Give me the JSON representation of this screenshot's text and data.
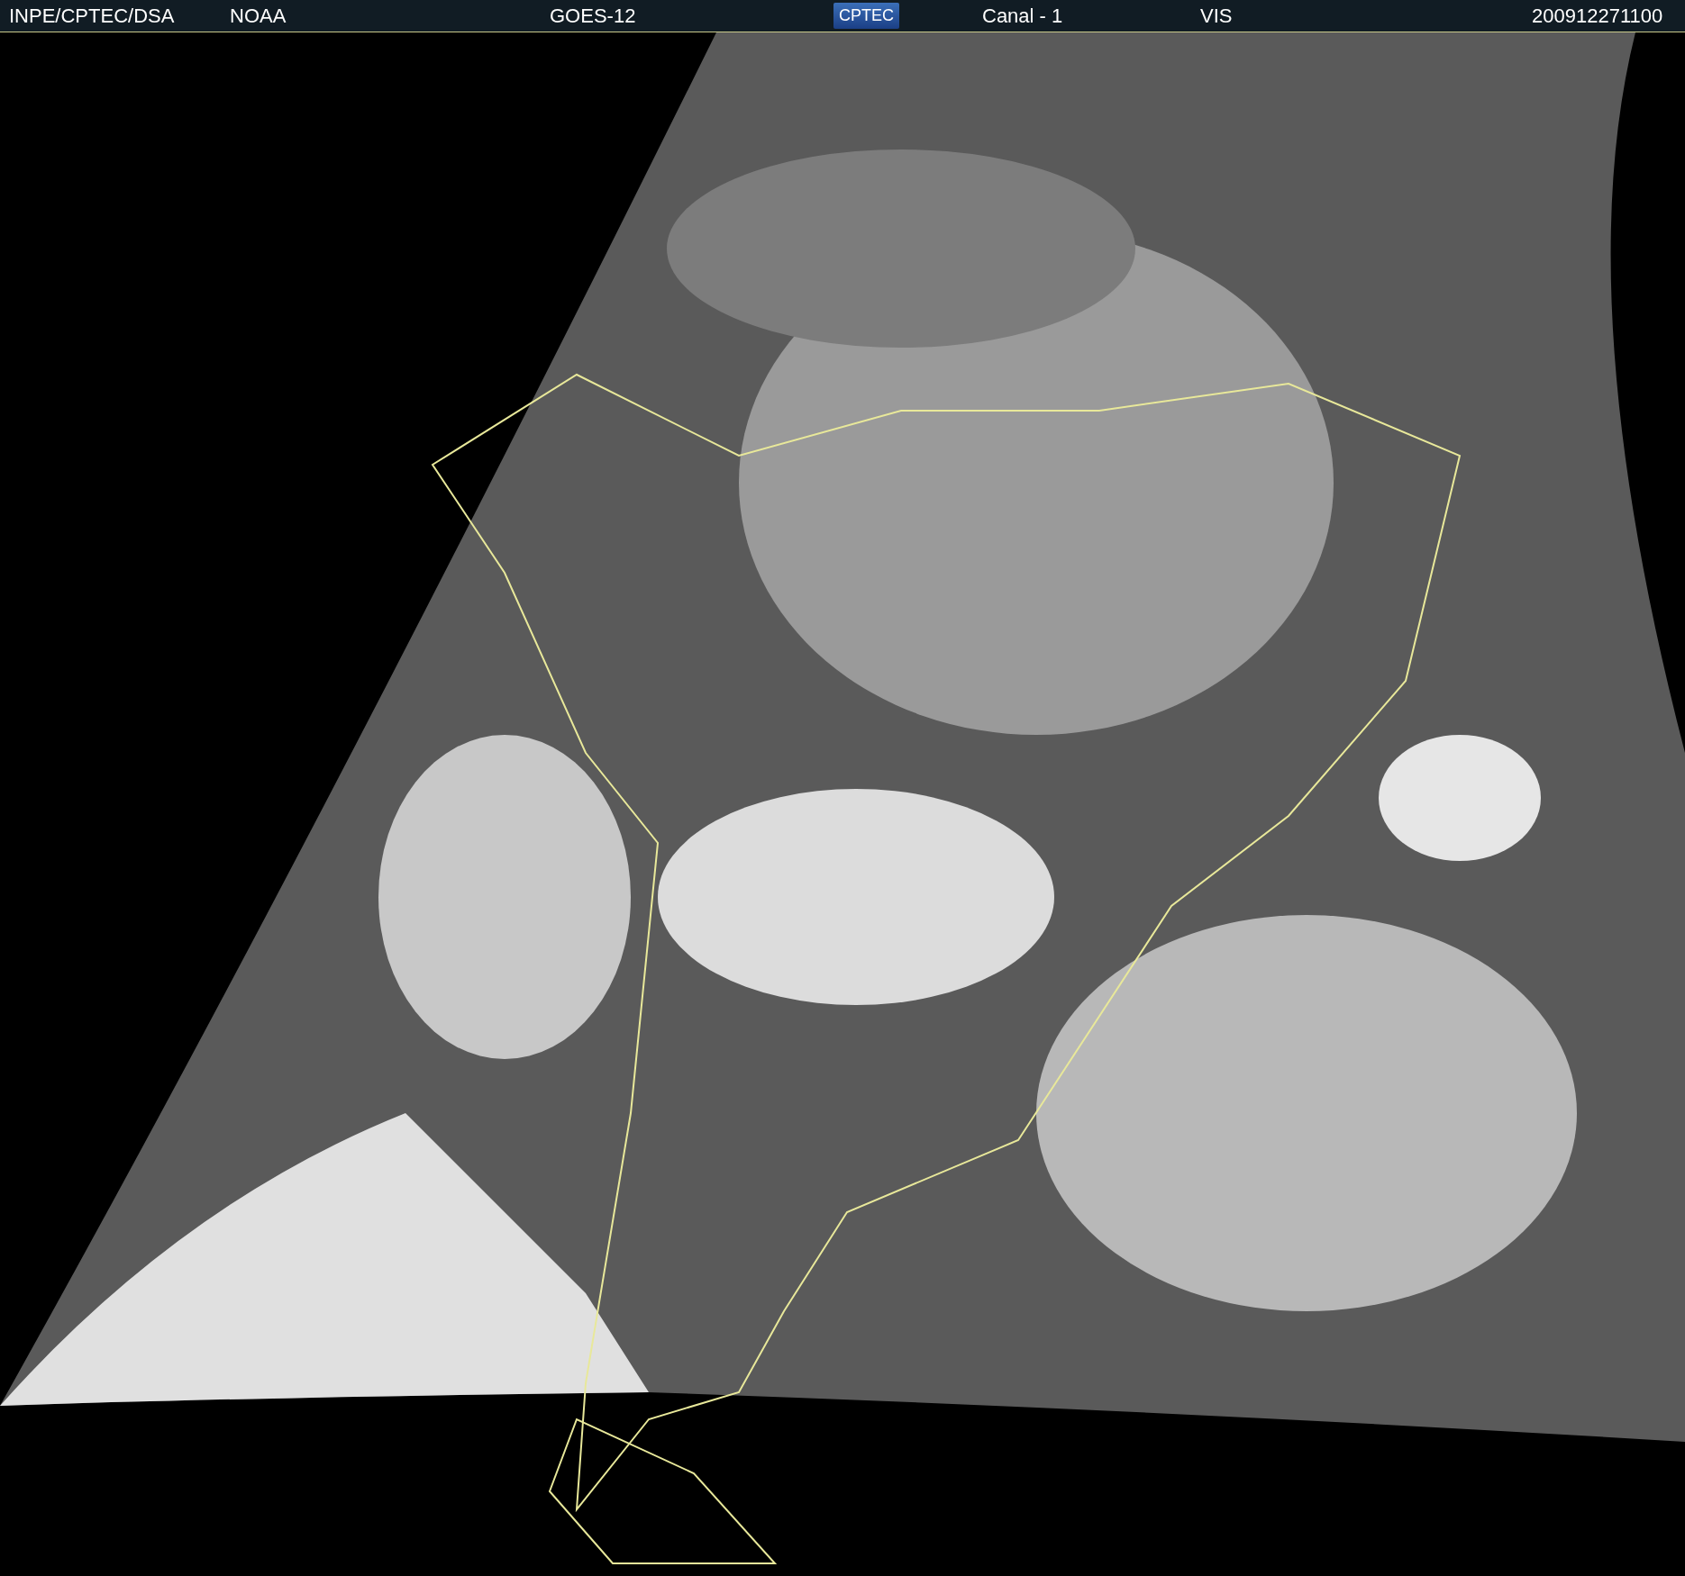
{
  "header": {
    "items": [
      {
        "kind": "text",
        "text": "INPE/CPTEC/DSA"
      },
      {
        "kind": "text",
        "text": "NOAA"
      },
      {
        "kind": "text",
        "text": "GOES-12"
      },
      {
        "kind": "logo",
        "text": "CPTEC"
      },
      {
        "kind": "text",
        "text": "Canal - 1"
      },
      {
        "kind": "text",
        "text": "VIS"
      },
      {
        "kind": "text",
        "text": "200912271100"
      }
    ]
  }
}
